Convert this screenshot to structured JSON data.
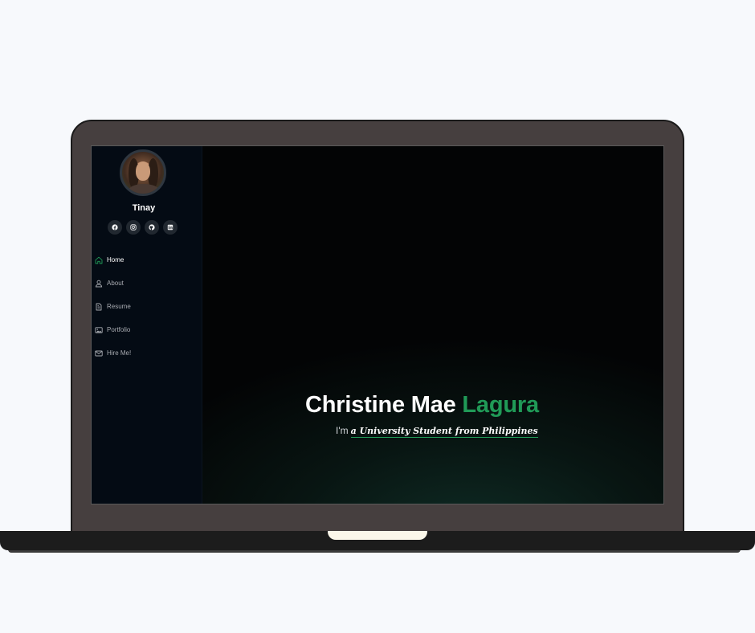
{
  "sidebar": {
    "name": "Tinay",
    "socials": [
      {
        "icon": "facebook-icon"
      },
      {
        "icon": "instagram-icon"
      },
      {
        "icon": "github-icon"
      },
      {
        "icon": "linkedin-icon"
      }
    ],
    "nav": [
      {
        "label": "Home",
        "icon": "home-icon",
        "active": true
      },
      {
        "label": "About",
        "icon": "person-icon",
        "active": false
      },
      {
        "label": "Resume",
        "icon": "document-icon",
        "active": false
      },
      {
        "label": "Portfolio",
        "icon": "images-icon",
        "active": false
      },
      {
        "label": "Hire Me!",
        "icon": "envelope-icon",
        "active": false
      }
    ]
  },
  "hero": {
    "first_name": "Christine Mae",
    "last_name": "Lagura",
    "intro": "I'm",
    "typed_text": "a University Student from Philippines"
  },
  "colors": {
    "accent": "#209a57",
    "laptop": "#463f3f",
    "sidebar_bg": "#040b14",
    "page_bg": "#f7f9fc"
  }
}
